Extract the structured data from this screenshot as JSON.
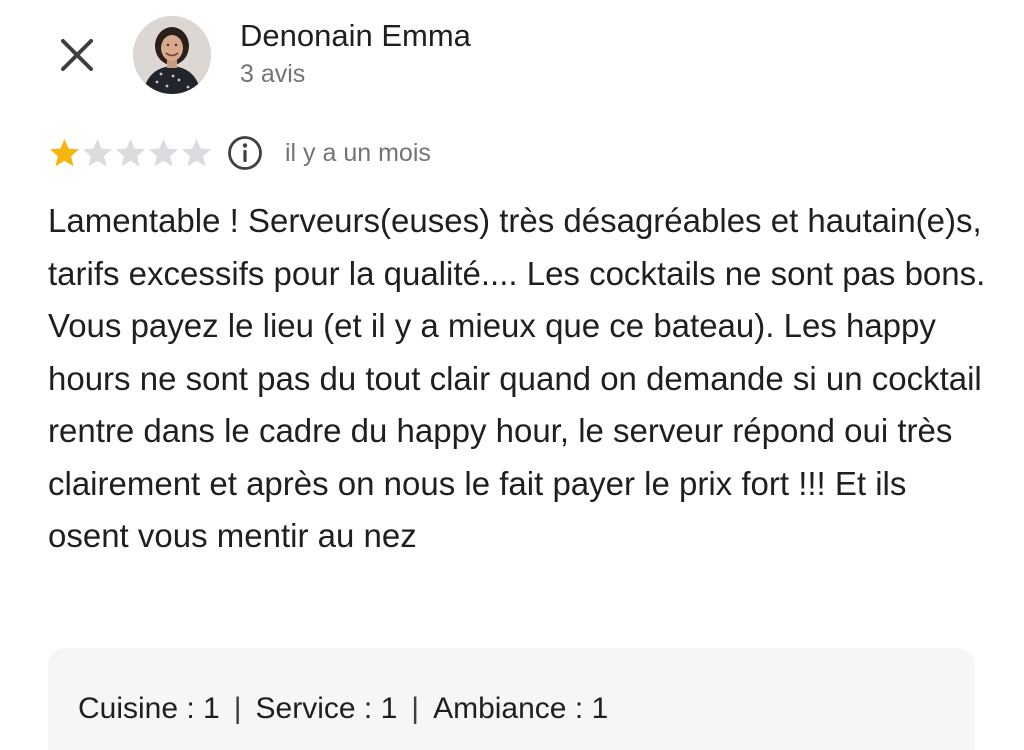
{
  "header": {
    "close_icon": "close-icon",
    "author_name": "Denonain Emma",
    "review_count": "3 avis"
  },
  "review": {
    "rating": 1,
    "max_rating": 5,
    "colors": {
      "star_filled": "#f6b40e",
      "star_empty": "#dadce0",
      "secondary_text": "#70757a"
    },
    "info_icon": "info-icon",
    "date": "il y a un mois",
    "text": "Lamentable ! Serveurs(euses) très désagréables et hautain(e)s, tarifs excessifs pour la qualité.... Les cocktails ne sont pas bons. Vous payez le lieu (et il y a mieux que ce bateau). Les happy hours ne sont pas du tout clair quand on demande si un cocktail rentre dans le cadre du happy hour, le serveur répond oui très clairement et après on nous le fait payer le prix fort !!! Et ils osent vous mentir au nez"
  },
  "sub_ratings": {
    "cuisine": "Cuisine : 1",
    "service": "Service : 1",
    "ambiance": "Ambiance : 1",
    "separator": "|"
  }
}
